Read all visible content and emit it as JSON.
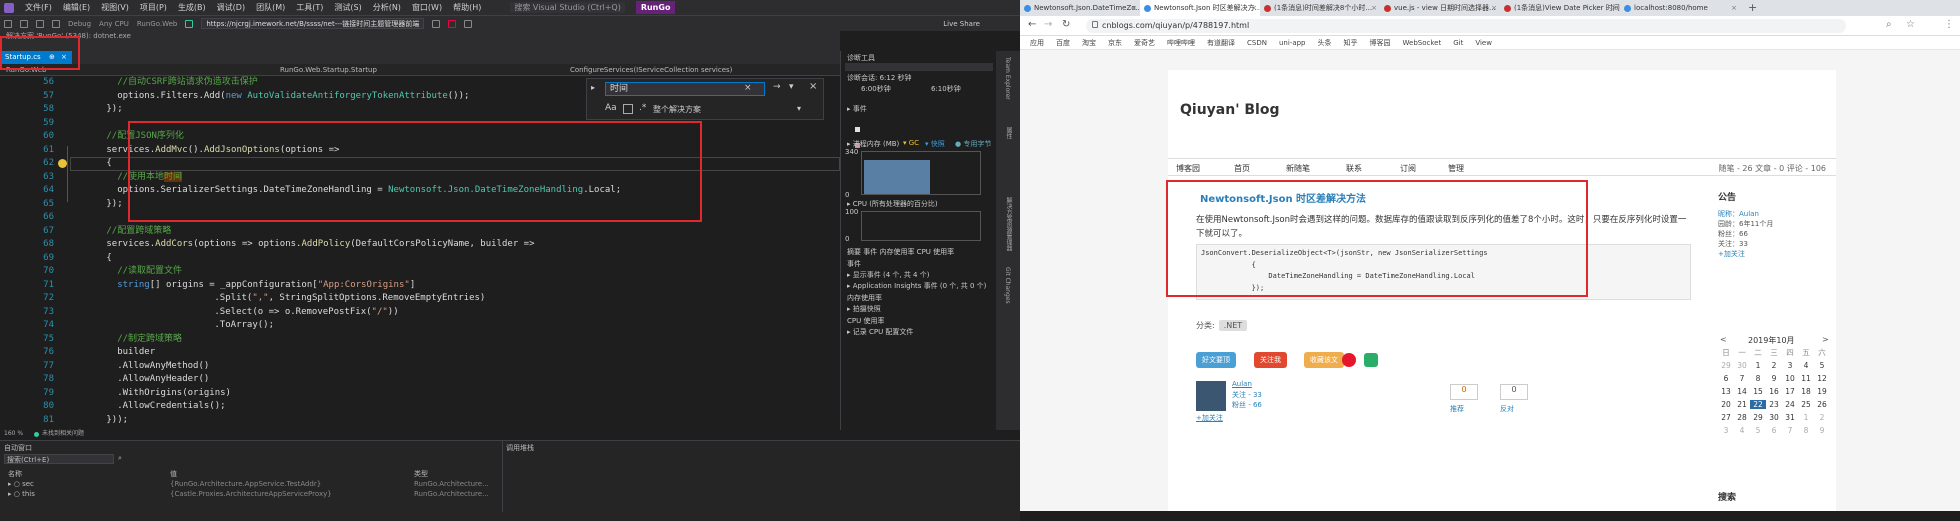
{
  "vs": {
    "menu": [
      "文件(F)",
      "编辑(E)",
      "视图(V)",
      "项目(P)",
      "生成(B)",
      "调试(D)",
      "团队(M)",
      "工具(T)",
      "测试(S)",
      "分析(N)",
      "窗口(W)",
      "帮助(H)"
    ],
    "search_label": "搜索 Visual Studio (Ctrl+Q)",
    "run_button": "RunGo",
    "toolbar": {
      "config": "Debug",
      "platform": "Any CPU",
      "project": "RunGo.Web",
      "url": "https://njcrgj.imework.net/B/ssss/net---链接时间主题管理器前端",
      "live_share": "Live Share"
    },
    "row3": "解决方案 'RunGo' (5348): dotnet.exe",
    "tab": "Startup.cs",
    "tab_mark": "⊕",
    "nav": {
      "project": "RunGo.Web",
      "class": "RunGo.Web.Startup.Startup",
      "method": "ConfigureServices(IServiceCollection services)"
    },
    "find": {
      "value": "时间",
      "scope": "整个解决方案"
    },
    "line_numbers": [
      "56",
      "57",
      "58",
      "59",
      "60",
      "61",
      "62",
      "63",
      "64",
      "65",
      "66",
      "67",
      "68",
      "69",
      "70",
      "71",
      "72",
      "73",
      "74",
      "75",
      "76",
      "77",
      "78",
      "79",
      "80",
      "81"
    ],
    "code": [
      {
        "indent": 8,
        "parts": [
          {
            "t": "//自动CSRF跨站请求伪造攻击保护",
            "c": "c-com"
          }
        ]
      },
      {
        "indent": 8,
        "parts": [
          {
            "t": "options.Filters.Add(",
            "c": ""
          },
          {
            "t": "new ",
            "c": "c-kw"
          },
          {
            "t": "AutoValidateAntiforgeryTokenAttribute",
            "c": "c-typ"
          },
          {
            "t": "());",
            "c": ""
          }
        ]
      },
      {
        "indent": 6,
        "parts": [
          {
            "t": "});",
            "c": ""
          }
        ]
      },
      {
        "indent": 0,
        "parts": []
      },
      {
        "indent": 6,
        "parts": [
          {
            "t": "//配置JSON序列化",
            "c": "c-com"
          }
        ]
      },
      {
        "indent": 6,
        "parts": [
          {
            "t": "services.",
            "c": ""
          },
          {
            "t": "AddMvc",
            "c": "c-mth"
          },
          {
            "t": "().",
            "c": ""
          },
          {
            "t": "AddJsonOptions",
            "c": "c-mth"
          },
          {
            "t": "(options =>",
            "c": ""
          }
        ]
      },
      {
        "indent": 6,
        "parts": [
          {
            "t": "{",
            "c": ""
          }
        ]
      },
      {
        "indent": 8,
        "parts": [
          {
            "t": "//使用本地",
            "c": "c-com"
          },
          {
            "t": "时间",
            "c": "c-com c-hl"
          }
        ]
      },
      {
        "indent": 8,
        "parts": [
          {
            "t": "options.SerializerSettings.DateTimeZoneHandling = ",
            "c": ""
          },
          {
            "t": "Newtonsoft.Json.DateTimeZoneHandling",
            "c": "c-typ"
          },
          {
            "t": ".Local;",
            "c": ""
          }
        ]
      },
      {
        "indent": 6,
        "parts": [
          {
            "t": "});",
            "c": ""
          }
        ]
      },
      {
        "indent": 0,
        "parts": []
      },
      {
        "indent": 6,
        "parts": [
          {
            "t": "//配置跨域策略",
            "c": "c-com"
          }
        ]
      },
      {
        "indent": 6,
        "parts": [
          {
            "t": "services.",
            "c": ""
          },
          {
            "t": "AddCors",
            "c": "c-mth"
          },
          {
            "t": "(options => options.",
            "c": ""
          },
          {
            "t": "AddPolicy",
            "c": "c-mth"
          },
          {
            "t": "(DefaultCorsPolicyName, builder =>",
            "c": ""
          }
        ]
      },
      {
        "indent": 6,
        "parts": [
          {
            "t": "{",
            "c": ""
          }
        ]
      },
      {
        "indent": 8,
        "parts": [
          {
            "t": "//读取配置文件",
            "c": "c-com"
          }
        ]
      },
      {
        "indent": 8,
        "parts": [
          {
            "t": "string",
            "c": "c-kw"
          },
          {
            "t": "[] origins = _appConfiguration[",
            "c": ""
          },
          {
            "t": "\"App:CorsOrigins\"",
            "c": "c-str"
          },
          {
            "t": "]",
            "c": ""
          }
        ]
      },
      {
        "indent": 26,
        "parts": [
          {
            "t": ".Split(",
            "c": ""
          },
          {
            "t": "\",\"",
            "c": "c-str"
          },
          {
            "t": ", StringSplitOptions.RemoveEmptyEntries)",
            "c": ""
          }
        ]
      },
      {
        "indent": 26,
        "parts": [
          {
            "t": ".Select(o => o.RemovePostFix(",
            "c": ""
          },
          {
            "t": "\"/\"",
            "c": "c-str"
          },
          {
            "t": "))",
            "c": ""
          }
        ]
      },
      {
        "indent": 26,
        "parts": [
          {
            "t": ".ToArray();",
            "c": ""
          }
        ]
      },
      {
        "indent": 8,
        "parts": [
          {
            "t": "//制定跨域策略",
            "c": "c-com"
          }
        ]
      },
      {
        "indent": 8,
        "parts": [
          {
            "t": "builder",
            "c": ""
          }
        ]
      },
      {
        "indent": 8,
        "parts": [
          {
            "t": ".AllowAnyMethod()",
            "c": ""
          }
        ]
      },
      {
        "indent": 8,
        "parts": [
          {
            "t": ".AllowAnyHeader()",
            "c": ""
          }
        ]
      },
      {
        "indent": 8,
        "parts": [
          {
            "t": ".WithOrigins(origins)",
            "c": ""
          }
        ]
      },
      {
        "indent": 8,
        "parts": [
          {
            "t": ".AllowCredentials();",
            "c": ""
          }
        ]
      },
      {
        "indent": 6,
        "parts": [
          {
            "t": "}));",
            "c": ""
          }
        ]
      }
    ],
    "zoom": "160 %",
    "status": "未找到相关问题",
    "bottom": {
      "left_title": "自动窗口",
      "search": "搜索(Ctrl+E)",
      "cols": [
        "名称",
        "值",
        "类型"
      ],
      "rows": [
        [
          "▸ ○ sec",
          "{RunGo.Architecture.AppService.TestAddr}",
          "RunGo.Architecture..."
        ],
        [
          "▸ ○ this",
          "{Castle.Proxies.ArchitectureAppServiceProxy}",
          "RunGo.Architecture..."
        ]
      ],
      "right_title": "调用堆栈"
    },
    "diag": {
      "title": "诊断工具",
      "session": "诊断会话: 6:12 秒钟",
      "t1": "6:00秒钟",
      "t2": "6:10秒钟",
      "events": "▸ 事件",
      "memory": "▸ 进程内存 (MB)",
      "gc": "▾ GC",
      "snapshot": "▾ 快照",
      "private": "● 专用字节",
      "mem_hi": "340",
      "mem_lo": "0",
      "cpu": "▸ CPU (所有处理器的百分比)",
      "cpu_hi": "100",
      "cpu_lo": "0",
      "tabs": "摘要  事件  内存使用率  CPU 使用率",
      "ev_title": "事件",
      "ev1": "▸ 显示事件 (4 个, 共 4 个)",
      "ev2": "▸ Application Insights 事件 (0 个, 共 0 个)",
      "mem_title": "内存使用率",
      "mem_item": "▸ 拍摄快照",
      "cpu_title": "CPU 使用率",
      "cpu_item": "▸ 记录 CPU 配置文件"
    },
    "vscroll": [
      "Team Explorer",
      "属性",
      "解决方案资源管理器",
      "Git Changes"
    ]
  },
  "chrome": {
    "tabs": [
      {
        "title": "Newtonsoft.Json.DateTimeZo...",
        "color": "#3a8ee6"
      },
      {
        "title": "Newtonsoft.Json 时区差解决方...",
        "color": "#3a8ee6",
        "active": true
      },
      {
        "title": "(1条消息)时间差解决8个小时...",
        "color": "#c9302c"
      },
      {
        "title": "vue.js - view 日期时间选择器...",
        "color": "#c9302c"
      },
      {
        "title": "(1条消息)View Date Picker 时间...",
        "color": "#c9302c"
      },
      {
        "title": "localhost:8080/home",
        "color": "#3a8ee6"
      }
    ],
    "new_tab": "+",
    "url": "cnblogs.com/qiuyan/p/4788197.html",
    "bookmarks": [
      "应用",
      "百度",
      "淘宝",
      "京东",
      "爱奇艺",
      "哔哩哔哩",
      "有道翻译",
      "CSDN",
      "uni-app",
      "头条",
      "知乎",
      "博客园",
      "WebSocket",
      "Git",
      "View"
    ],
    "page": {
      "blog_title": "Qiuyan' Blog",
      "nav": [
        "博客园",
        "首页",
        "新随笔",
        "联系",
        "订阅",
        "管理"
      ],
      "nav_stats": "随笔 - 26  文章 - 0  评论 - 106",
      "post_title": "Newtonsoft.Json 时区差解决方法",
      "post_text": "在使用Newtonsoft.Json时会遇到这样的问题。数据库存的值跟读取到反序列化的值差了8个小时。这时，只要在反序列化时设置一下就可以了。",
      "code": "JsonConvert.DeserializeObject<T>(jsonStr, new JsonSerializerSettings\n            {\n                DateTimeZoneHandling = DateTimeZoneHandling.Local\n            });",
      "tag_label": "分类:",
      "tag": ".NET",
      "share": [
        {
          "label": "好文要顶",
          "color": "#4a9fd5"
        },
        {
          "label": "关注我",
          "color": "#e0482f"
        },
        {
          "label": "收藏该文",
          "color": "#f0ad4e"
        }
      ],
      "author": "Aulan",
      "follow": "关注 - 33",
      "fans": "粉丝 - 66",
      "add_follow": "+加关注",
      "up": "0",
      "down": "0",
      "up_label": "推荐",
      "down_label": "反对",
      "side": {
        "title": "公告",
        "lines": [
          "昵称：Aulan",
          "园龄：6年11个月",
          "粉丝：66",
          "关注：33",
          "+加关注"
        ]
      },
      "cal": {
        "prev": "<",
        "next": ">",
        "title": "2019年10月",
        "head": [
          "日",
          "一",
          "二",
          "三",
          "四",
          "五",
          "六"
        ],
        "days": [
          [
            "29",
            "30",
            "1",
            "2",
            "3",
            "4",
            "5"
          ],
          [
            "6",
            "7",
            "8",
            "9",
            "10",
            "11",
            "12"
          ],
          [
            "13",
            "14",
            "15",
            "16",
            "17",
            "18",
            "19"
          ],
          [
            "20",
            "21",
            "22",
            "23",
            "24",
            "25",
            "26"
          ],
          [
            "27",
            "28",
            "29",
            "30",
            "31",
            "1",
            "2"
          ],
          [
            "3",
            "4",
            "5",
            "6",
            "7",
            "8",
            "9"
          ]
        ],
        "today": "22"
      },
      "search_title": "搜索"
    }
  },
  "colors": {
    "vs_bg": "#1e1e1e",
    "vs_accent": "#007acc",
    "red_box": "#e0282f",
    "cal_today": "#2d6ca2"
  }
}
